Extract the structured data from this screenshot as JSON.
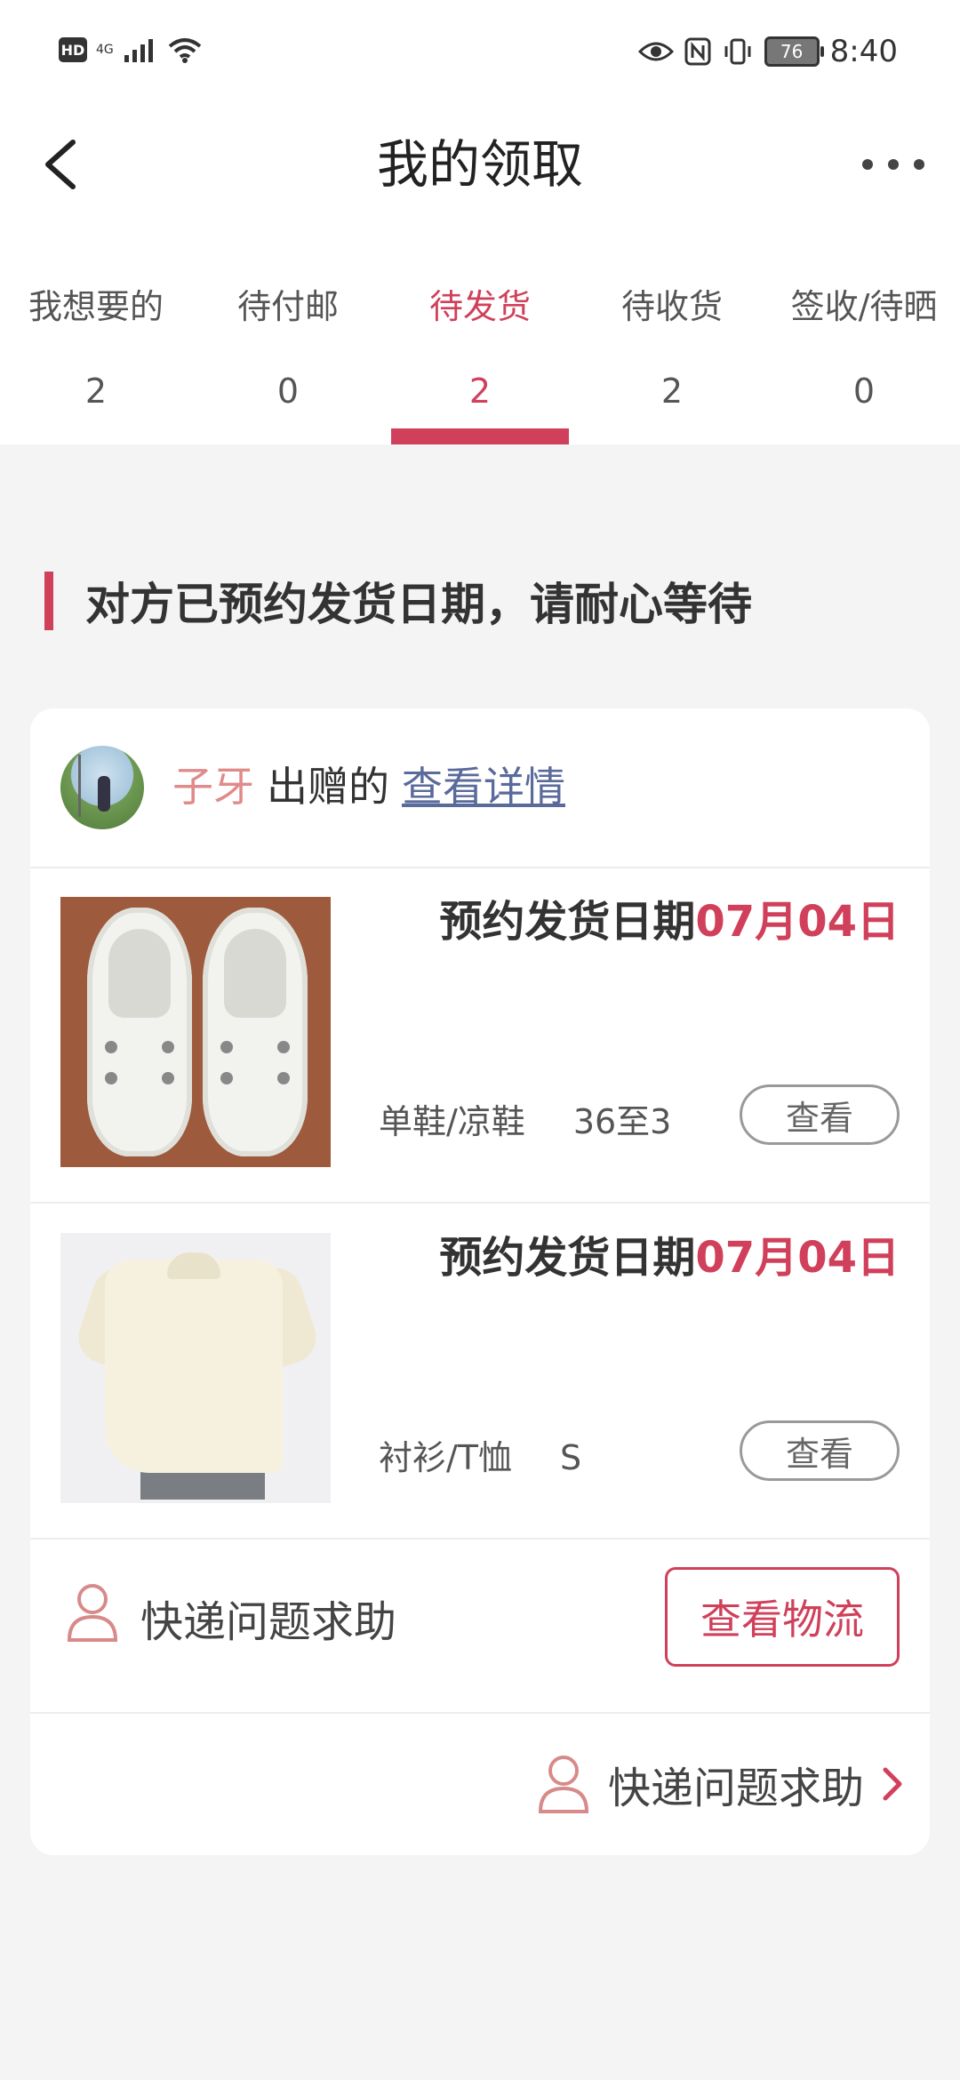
{
  "status_bar": {
    "left_indicator": "HD",
    "network": "4G",
    "battery": "76",
    "time": "8:40"
  },
  "header": {
    "title": "我的领取"
  },
  "tabs": [
    {
      "label": "我想要的",
      "count": "2"
    },
    {
      "label": "待付邮",
      "count": "0"
    },
    {
      "label": "待发货",
      "count": "2",
      "active": true
    },
    {
      "label": "待收货",
      "count": "2"
    },
    {
      "label": "签收/待晒",
      "count": "0"
    }
  ],
  "section": {
    "title": "对方已预约发货日期，请耐心等待"
  },
  "order": {
    "giver_name": "子牙",
    "giver_action": "出赠的",
    "detail_link": "查看详情",
    "items": [
      {
        "ship_date_label": "预约发货日期",
        "ship_date": "07月04日",
        "category": "单鞋/凉鞋",
        "size": "36至3",
        "view_label": "查看"
      },
      {
        "ship_date_label": "预约发货日期",
        "ship_date": "07月04日",
        "category": "衬衫/T恤",
        "size": "S",
        "view_label": "查看"
      }
    ],
    "help_label": "快递问题求助",
    "logistics_label": "查看物流",
    "bottom_help_label": "快递问题求助"
  },
  "colors": {
    "accent": "#d0405a",
    "background": "#f4f4f4"
  }
}
